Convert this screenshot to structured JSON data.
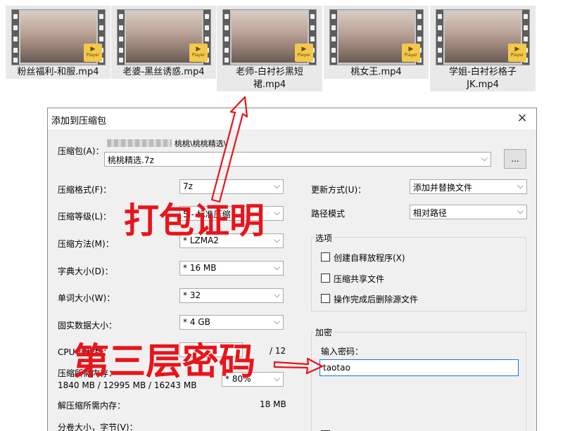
{
  "files": [
    {
      "name": "粉丝福利-和服.mp4",
      "badge": "Player"
    },
    {
      "name": "老婆-黑丝诱惑.mp4",
      "badge": "Player"
    },
    {
      "name": "老师-白衬衫黑短裙.mp4",
      "badge": "Player"
    },
    {
      "name": "桃女王.mp4",
      "badge": "Player"
    },
    {
      "name": "学姐-白衬衫格子JK.mp4",
      "badge": "Player"
    }
  ],
  "dialog": {
    "title": "添加到压缩包",
    "close_icon": "×",
    "archive_label": "压缩包(A)：",
    "archive_path_tail": "桃桃\\桃桃精选\\",
    "archive_name": "桃桃精选.7z",
    "browse_label": "...",
    "format_label": "压缩格式(F)：",
    "format_value": "7z",
    "level_label": "压缩等级(L)：",
    "level_value": "5 - 标准压缩",
    "method_label": "压缩方法(M)：",
    "method_value": "* LZMA2",
    "dict_label": "字典大小(D)：",
    "dict_value": "* 16 MB",
    "word_label": "单词大小(W)：",
    "word_value": "* 32",
    "solid_label": "固实数据大小：",
    "solid_value": "* 4 GB",
    "cpu_label": "CPU 线程数：",
    "cpu_total": "/ 12",
    "mem_label": "压缩所需内存：",
    "mem_value": "1840 MB / 12995 MB / 16243 MB",
    "mem_percent": "* 80%",
    "decomp_label": "解压缩所需内存：",
    "decomp_value": "18 MB",
    "split_label": "分卷大小，字节(V)：",
    "update_label": "更新方式(U)：",
    "update_value": "添加并替换文件",
    "path_label": "路径模式",
    "path_value": "相对路径",
    "options_title": "选项",
    "options": [
      "创建自释放程序(X)",
      "压缩共享文件",
      "操作完成后删除源文件"
    ],
    "encrypt_title": "加密",
    "password_label": "输入密码：",
    "password_value": "taotao",
    "dropdown_icon": "⌵"
  },
  "annotations": {
    "pack_proof": "打包证明",
    "third_layer_password": "第三层密码",
    "accent": "#e8141a"
  }
}
